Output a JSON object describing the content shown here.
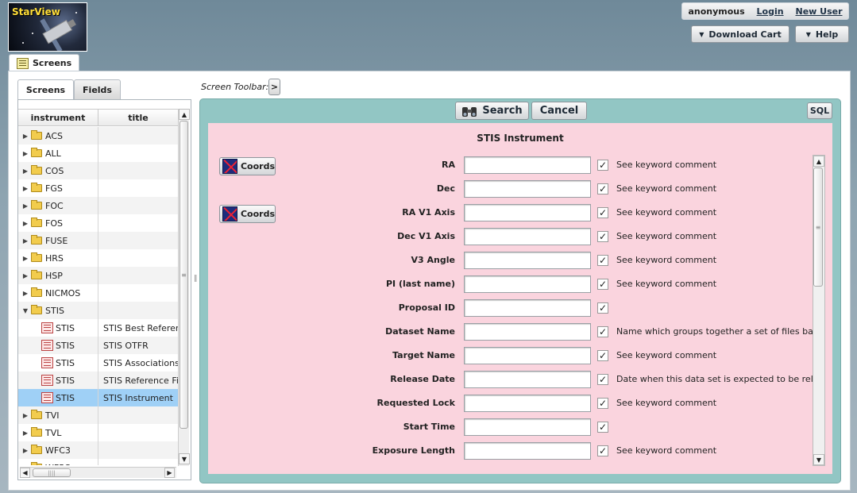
{
  "app": {
    "logo_text": "StarView"
  },
  "user": {
    "name": "anonymous",
    "login": "Login",
    "new_user": "New User"
  },
  "header_buttons": {
    "download_cart": "Download Cart",
    "help": "Help"
  },
  "main_tab": {
    "label": "Screens"
  },
  "left_tabs": {
    "screens": "Screens",
    "fields": "Fields"
  },
  "tree": {
    "col_instrument": "instrument",
    "col_title": "title",
    "rows": [
      {
        "kind": "folder",
        "expanded": false,
        "instrument": "ACS",
        "title": ""
      },
      {
        "kind": "folder",
        "expanded": false,
        "instrument": "ALL",
        "title": ""
      },
      {
        "kind": "folder",
        "expanded": false,
        "instrument": "COS",
        "title": ""
      },
      {
        "kind": "folder",
        "expanded": false,
        "instrument": "FGS",
        "title": ""
      },
      {
        "kind": "folder",
        "expanded": false,
        "instrument": "FOC",
        "title": ""
      },
      {
        "kind": "folder",
        "expanded": false,
        "instrument": "FOS",
        "title": ""
      },
      {
        "kind": "folder",
        "expanded": false,
        "instrument": "FUSE",
        "title": ""
      },
      {
        "kind": "folder",
        "expanded": false,
        "instrument": "HRS",
        "title": ""
      },
      {
        "kind": "folder",
        "expanded": false,
        "instrument": "HSP",
        "title": ""
      },
      {
        "kind": "folder",
        "expanded": false,
        "instrument": "NICMOS",
        "title": ""
      },
      {
        "kind": "folder",
        "expanded": true,
        "instrument": "STIS",
        "title": ""
      },
      {
        "kind": "screen",
        "selected": false,
        "instrument": "STIS",
        "title": "STIS Best Referen"
      },
      {
        "kind": "screen",
        "selected": false,
        "instrument": "STIS",
        "title": "STIS OTFR"
      },
      {
        "kind": "screen",
        "selected": false,
        "instrument": "STIS",
        "title": "STIS Associations"
      },
      {
        "kind": "screen",
        "selected": false,
        "instrument": "STIS",
        "title": "STIS Reference Fil"
      },
      {
        "kind": "screen",
        "selected": true,
        "instrument": "STIS",
        "title": "STIS Instrument"
      },
      {
        "kind": "folder",
        "expanded": false,
        "instrument": "TVI",
        "title": ""
      },
      {
        "kind": "folder",
        "expanded": false,
        "instrument": "TVL",
        "title": ""
      },
      {
        "kind": "folder",
        "expanded": false,
        "instrument": "WFC3",
        "title": ""
      },
      {
        "kind": "folder",
        "expanded": false,
        "instrument": "WFPC",
        "title": ""
      }
    ]
  },
  "toolbar": {
    "label": "Screen Toolbar:",
    "toggle": ">"
  },
  "form": {
    "search": "Search",
    "cancel": "Cancel",
    "sql": "SQL",
    "title": "STIS Instrument",
    "coords_label": "Coords",
    "fields": [
      {
        "label": "RA",
        "value": "",
        "checked": true,
        "comment": "See keyword comment",
        "coords": true
      },
      {
        "label": "Dec",
        "value": "",
        "checked": true,
        "comment": "See keyword comment",
        "coords": false
      },
      {
        "label": "RA V1 Axis",
        "value": "",
        "checked": true,
        "comment": "See keyword comment",
        "coords": true
      },
      {
        "label": "Dec V1 Axis",
        "value": "",
        "checked": true,
        "comment": "See keyword comment",
        "coords": false
      },
      {
        "label": "V3 Angle",
        "value": "",
        "checked": true,
        "comment": "See keyword comment",
        "coords": false
      },
      {
        "label": "PI (last name)",
        "value": "",
        "checked": true,
        "comment": "See keyword comment",
        "coords": false
      },
      {
        "label": "Proposal ID",
        "value": "",
        "checked": true,
        "comment": "",
        "coords": false
      },
      {
        "label": "Dataset Name",
        "value": "",
        "checked": true,
        "comment": "Name which groups together a set of files based",
        "coords": false
      },
      {
        "label": "Target Name",
        "value": "",
        "checked": true,
        "comment": "See keyword comment",
        "coords": false
      },
      {
        "label": "Release Date",
        "value": "",
        "checked": true,
        "comment": "Date when this data set is expected to be release",
        "coords": false
      },
      {
        "label": "Requested Lock",
        "value": "",
        "checked": true,
        "comment": "See keyword comment",
        "coords": false
      },
      {
        "label": "Start Time",
        "value": "",
        "checked": true,
        "comment": "",
        "coords": false
      },
      {
        "label": "Exposure Length",
        "value": "",
        "checked": true,
        "comment": "See keyword comment",
        "coords": false
      }
    ]
  }
}
